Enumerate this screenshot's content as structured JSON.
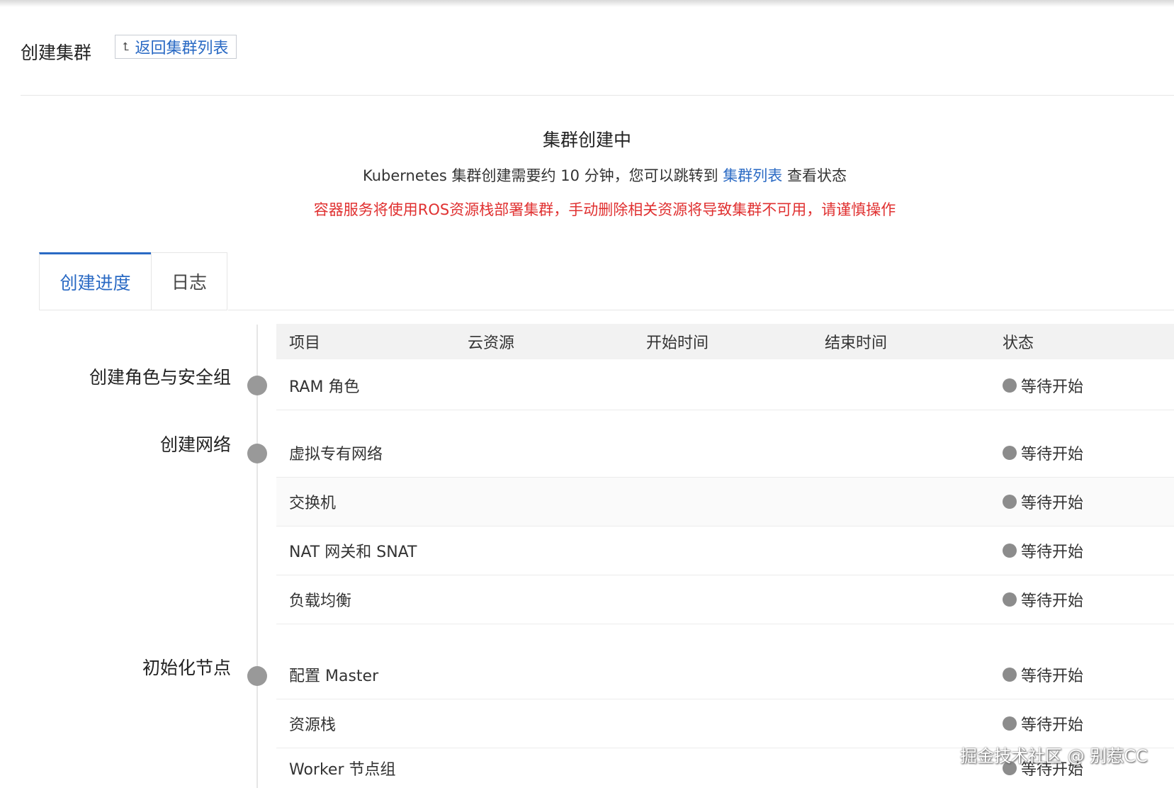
{
  "header": {
    "title": "创建集群",
    "back_button": "返回集群列表"
  },
  "status": {
    "title": "集群创建中",
    "desc_before": "Kubernetes 集群创建需要约 10 分钟，您可以跳转到 ",
    "desc_link": "集群列表",
    "desc_after": " 查看状态",
    "warning": "容器服务将使用ROS资源栈部署集群，手动删除相关资源将导致集群不可用，请谨慎操作"
  },
  "tabs": [
    "创建进度",
    "日志"
  ],
  "table": {
    "headers": [
      "项目",
      "云资源",
      "开始时间",
      "结束时间",
      "状态"
    ]
  },
  "groups": [
    {
      "label": "创建角色与安全组",
      "items": [
        {
          "name": "RAM 角色",
          "status": "等待开始"
        }
      ]
    },
    {
      "label": "创建网络",
      "items": [
        {
          "name": "虚拟专有网络",
          "status": "等待开始"
        },
        {
          "name": "交换机",
          "status": "等待开始"
        },
        {
          "name": "NAT 网关和 SNAT",
          "status": "等待开始"
        },
        {
          "name": "负载均衡",
          "status": "等待开始"
        }
      ]
    },
    {
      "label": "初始化节点",
      "items": [
        {
          "name": "配置 Master",
          "status": "等待开始"
        },
        {
          "name": "资源栈",
          "status": "等待开始"
        },
        {
          "name": "Worker 节点组",
          "status": "等待开始"
        }
      ]
    }
  ],
  "watermark": "掘金技术社区 @ 别惹CC",
  "colors": {
    "link": "#2a6ac4",
    "warning": "#e03131",
    "pending_dot": "#8c8c8c"
  }
}
